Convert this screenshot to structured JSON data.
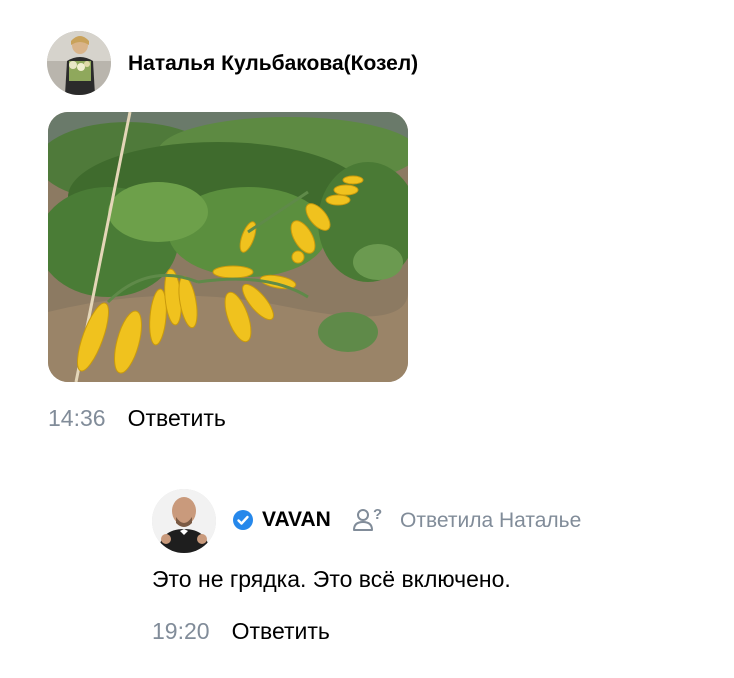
{
  "comments": [
    {
      "author": "Наталья Кульбакова(Козел)",
      "time": "14:36",
      "reply_label": "Ответить",
      "attachment": "photo-zucchini"
    },
    {
      "author": "VAVAN",
      "verified": true,
      "reply_to": "Ответила Наталье",
      "text": "Это не грядка. Это всё включено.",
      "time": "19:20",
      "reply_label": "Ответить"
    }
  ],
  "colors": {
    "secondary_text": "#818c99",
    "verified_blue": "#2688eb"
  }
}
